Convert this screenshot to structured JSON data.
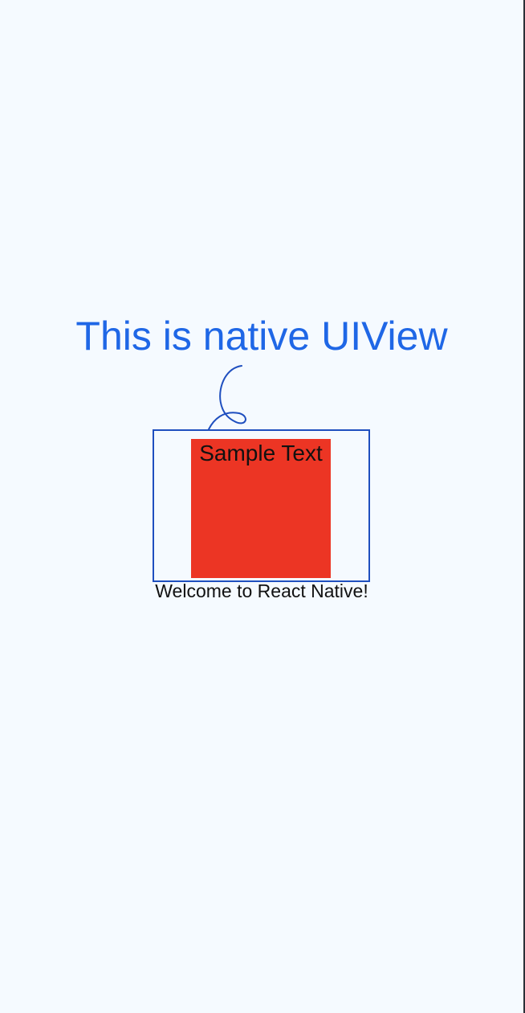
{
  "native_view": {
    "title": "This is native UIView",
    "title_color": "#1f67e6",
    "border_color": "#1f4fbf",
    "squiggle_icon": "loop-squiggle-icon"
  },
  "sample_box": {
    "text": "Sample Text",
    "color": "#ec3524"
  },
  "welcome": {
    "text": "Welcome to React Native!"
  },
  "background_color": "#f5faff"
}
